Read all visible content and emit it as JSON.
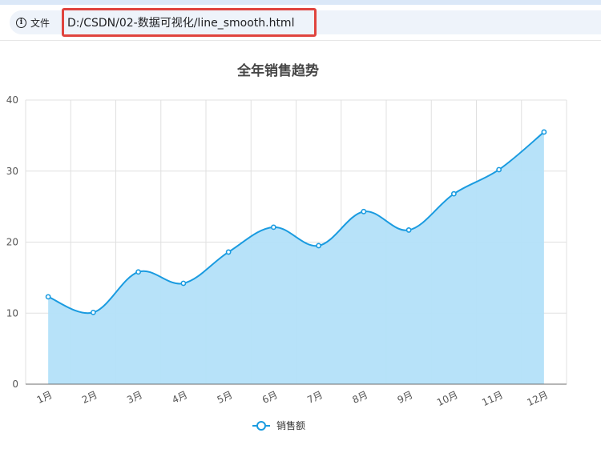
{
  "browser": {
    "info_icon": "info-icon",
    "file_label": "文件",
    "url": "D:/CSDN/02-数据可视化/line_smooth.html",
    "highlight_color": "#e0443e"
  },
  "chart_data": {
    "type": "area",
    "smooth": true,
    "title": "全年销售趋势",
    "categories": [
      "1月",
      "2月",
      "3月",
      "4月",
      "5月",
      "6月",
      "7月",
      "8月",
      "9月",
      "10月",
      "11月",
      "12月"
    ],
    "series": [
      {
        "name": "销售额",
        "values": [
          12.3,
          10.1,
          15.8,
          14.2,
          18.6,
          22.1,
          19.5,
          24.3,
          21.7,
          26.8,
          30.2,
          35.5
        ],
        "color": "#1a9be0",
        "area_color": "#b3e0f9"
      }
    ],
    "ylim": [
      0,
      40
    ],
    "yticks": [
      0,
      10,
      20,
      30,
      40
    ],
    "grid": true,
    "legend_position": "bottom-center"
  }
}
